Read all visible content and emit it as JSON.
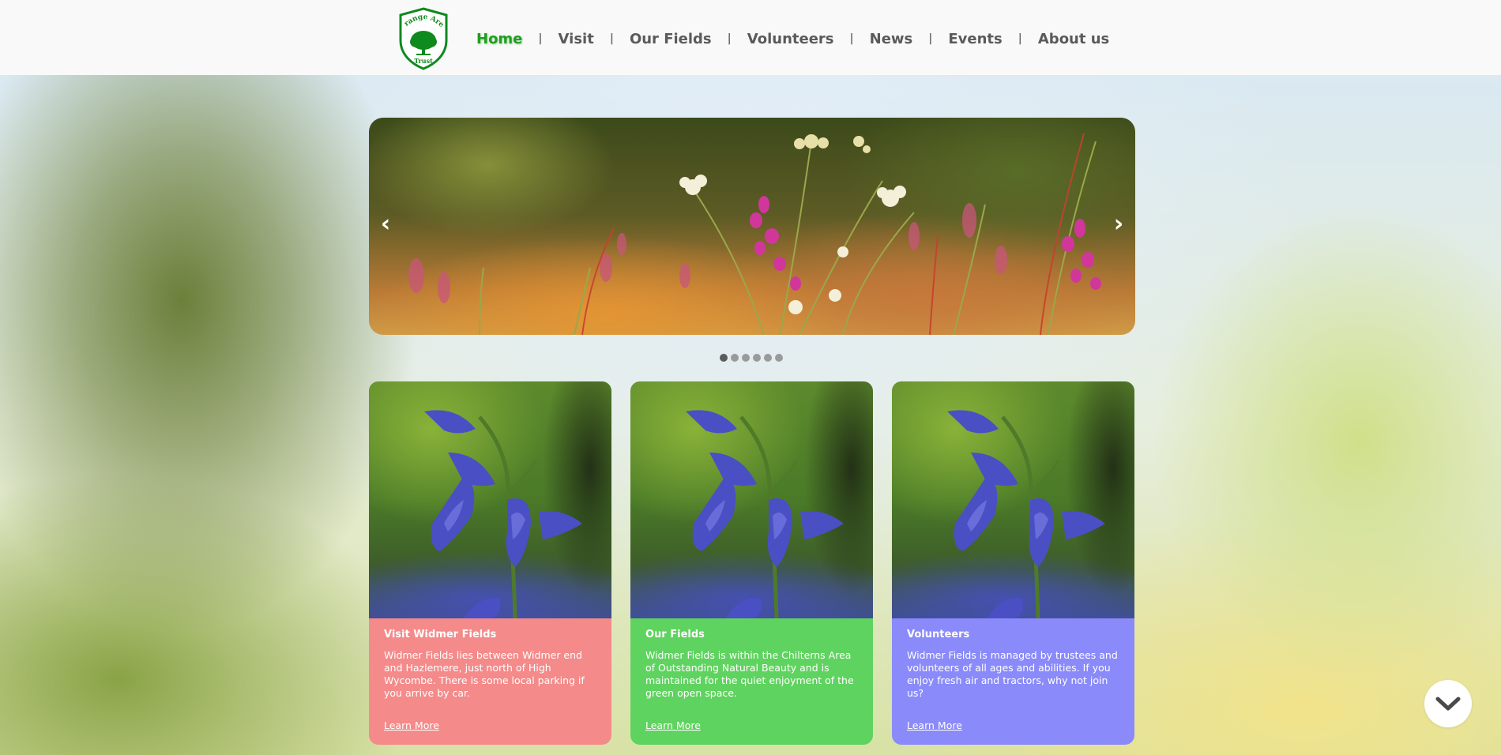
{
  "header": {
    "logo": {
      "top_text": "Grange Area",
      "bottom_text": "Trust",
      "icon": "tree-shield-logo"
    },
    "nav": [
      {
        "label": "Home",
        "active": true
      },
      {
        "label": "Visit"
      },
      {
        "label": "Our Fields"
      },
      {
        "label": "Volunteers"
      },
      {
        "label": "News"
      },
      {
        "label": "Events"
      },
      {
        "label": "About us"
      }
    ],
    "separator": "|"
  },
  "slider": {
    "prev_arrow": "‹",
    "next_arrow": "›",
    "slide_count": 6,
    "active_slide": 1
  },
  "cards": [
    {
      "title": "Visit Widmer Fields",
      "text": "Widmer Fields lies between Widmer end and Hazlemere, just north of High Wycombe. There is some local parking if you arrive by car.",
      "link": "Learn More",
      "color": "#f48a8a"
    },
    {
      "title": "Our Fields",
      "text": "Widmer Fields is within the Chilterns Area of Outstanding Natural Beauty and is maintained for the quiet enjoyment of the green open space.",
      "link": "Learn More",
      "color": "#5fd35f"
    },
    {
      "title": "Volunteers",
      "text": "Widmer Fields is managed by trustees and volunteers of all ages and abilities. If you enjoy fresh air and tractors, why not join us?",
      "link": "Learn More",
      "color": "#8a8afa"
    }
  ],
  "scroll_button": {
    "icon": "chevron-down-icon"
  },
  "colors": {
    "brand_green": "#1da01d",
    "nav_text": "#5a5a5a",
    "header_bg": "#f9f9f9"
  }
}
